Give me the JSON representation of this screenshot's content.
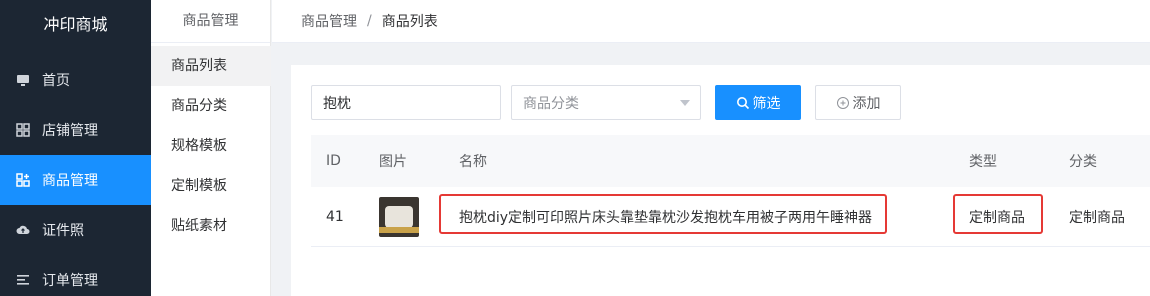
{
  "sidebar": {
    "brand": "冲印商城",
    "items": [
      {
        "label": "首页",
        "icon": "monitor-icon"
      },
      {
        "label": "店铺管理",
        "icon": "store-icon"
      },
      {
        "label": "商品管理",
        "icon": "goods-icon",
        "active": true
      },
      {
        "label": "证件照",
        "icon": "cloud-upload-icon"
      },
      {
        "label": "订单管理",
        "icon": "list-icon"
      }
    ]
  },
  "subsidebar": {
    "title": "商品管理",
    "items": [
      {
        "label": "商品列表",
        "active": true
      },
      {
        "label": "商品分类"
      },
      {
        "label": "规格模板"
      },
      {
        "label": "定制模板"
      },
      {
        "label": "贴纸素材"
      }
    ]
  },
  "breadcrumb": {
    "parent": "商品管理",
    "separator": "/",
    "current": "商品列表"
  },
  "filters": {
    "keyword_value": "抱枕",
    "category_placeholder": "商品分类",
    "search_label": "筛选",
    "add_label": "添加"
  },
  "table": {
    "columns": [
      "ID",
      "图片",
      "名称",
      "类型",
      "分类"
    ],
    "rows": [
      {
        "id": "41",
        "image": "pillow-product-thumbnail",
        "name": "抱枕diy定制可印照片床头靠垫靠枕沙发抱枕车用被子两用午睡神器",
        "type": "定制商品",
        "category": "定制商品"
      }
    ]
  },
  "colors": {
    "sidebar_bg": "#1c2633",
    "accent": "#1890ff",
    "highlight": "#e53935"
  }
}
